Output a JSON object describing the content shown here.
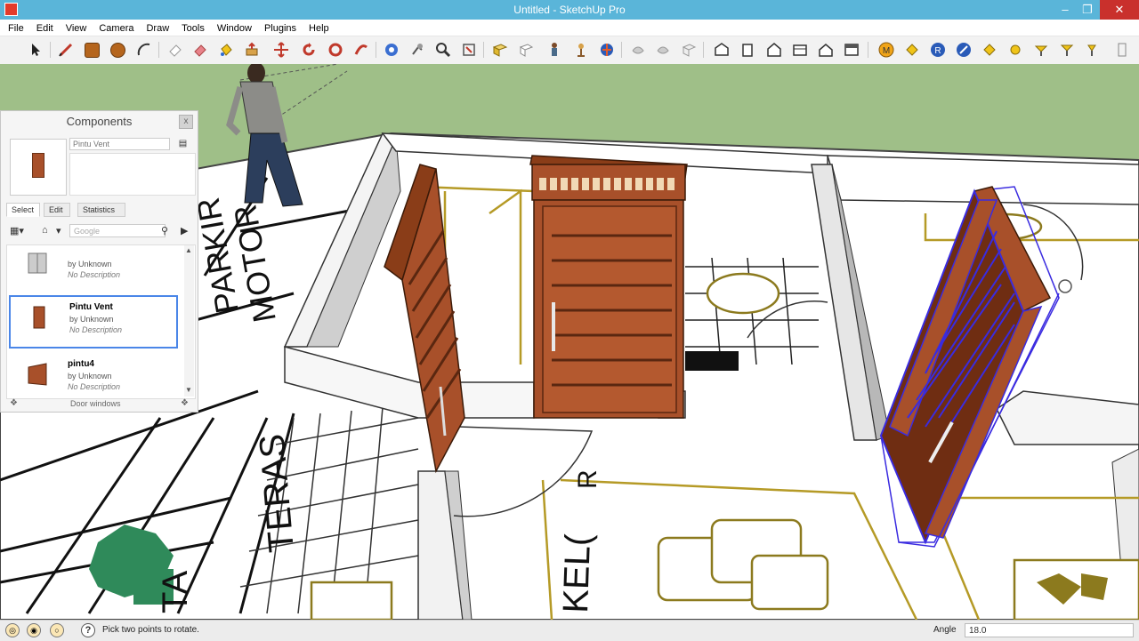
{
  "window": {
    "title": "Untitled - SketchUp Pro"
  },
  "menu": [
    "File",
    "Edit",
    "View",
    "Camera",
    "Draw",
    "Tools",
    "Window",
    "Plugins",
    "Help"
  ],
  "toolbar": {
    "tools": [
      "select-icon",
      "pencil-line-icon",
      "rectangle-icon",
      "circle-icon",
      "arc-icon",
      "eraser-outline-icon",
      "eraser-icon",
      "paint-bucket-icon",
      "push-pull-icon",
      "move-icon",
      "rotate-icon",
      "follow-me-icon",
      "orbit-icon",
      "pan-icon",
      "zoom-icon",
      "zoom-extents-icon",
      "section-plane-icon",
      "section-display-icon",
      "walk-icon",
      "position-camera-icon",
      "look-around-icon",
      "get-models-icon",
      "share-model-icon",
      "component-icon",
      "iso-view-icon",
      "top-view-icon",
      "front-view-icon",
      "right-view-icon",
      "back-view-icon",
      "left-view-icon",
      "extension-icon-1",
      "extension-icon-2",
      "extension-icon-3",
      "extension-icon-4",
      "extension-icon-5",
      "extension-icon-6",
      "extension-icon-7",
      "extension-icon-8",
      "extension-icon-9"
    ]
  },
  "scene": {
    "labels": {
      "parkir": "PARKIR",
      "motor": "MOTOR",
      "teras": "TERAS",
      "kel": "KEL(",
      "ta": "TA",
      "r": "R"
    }
  },
  "components": {
    "title": "Components",
    "close": "x",
    "name_value": "Pintu Vent",
    "tabs": [
      "Select",
      "Edit",
      "Statistics"
    ],
    "search_placeholder": "Google",
    "items": [
      {
        "name": "",
        "by": "by Unknown",
        "desc": "No Description"
      },
      {
        "name": "Pintu Vent",
        "by": "by Unknown",
        "desc": "No Description"
      },
      {
        "name": "pintu4",
        "by": "by Unknown",
        "desc": "No Description"
      }
    ],
    "footer": "Door  windows"
  },
  "status": {
    "message": "Pick two points to rotate.",
    "vcb_label": "Angle",
    "vcb_value": "18.0"
  },
  "colors": {
    "titlebar": "#5ab5d9",
    "door_wood": "#a8502a",
    "selection": "#3a2be0",
    "ground": "#9fbf88"
  }
}
